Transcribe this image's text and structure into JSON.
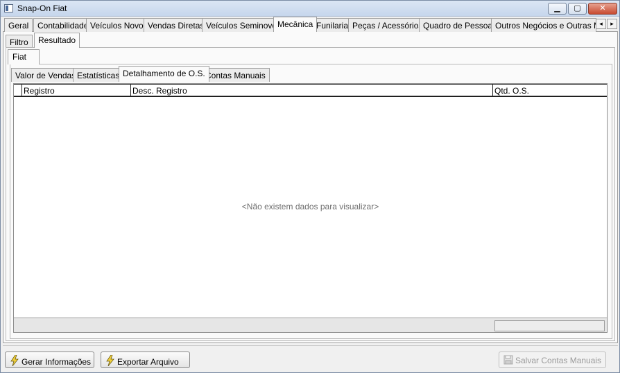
{
  "window": {
    "title": "Snap-On Fiat",
    "min_glyph": "▁",
    "max_glyph": "▢",
    "close_glyph": "✕"
  },
  "top_tabs": [
    {
      "label": "Geral"
    },
    {
      "label": "Contabilidade"
    },
    {
      "label": "Veículos Novos"
    },
    {
      "label": "Vendas Diretas"
    },
    {
      "label": "Veículos Seminovos"
    },
    {
      "label": "Mecânica",
      "active": true
    },
    {
      "label": "Funilaria"
    },
    {
      "label": "Peças / Acessórios"
    },
    {
      "label": "Quadro de Pessoas"
    },
    {
      "label": "Outros Negócios e Outras Mar"
    }
  ],
  "tab_scroll": {
    "left": "◂",
    "right": "▸"
  },
  "sub_tabs": [
    {
      "label": "Filtro"
    },
    {
      "label": "Resultado",
      "active": true
    }
  ],
  "brand_tab": {
    "label": "Fiat"
  },
  "detail_tabs": [
    {
      "label": "Valor de Vendas"
    },
    {
      "label": "Estatísticas"
    },
    {
      "label": "Detalhamento de O.S.",
      "active": true
    },
    {
      "label": "Contas Manuais"
    }
  ],
  "grid": {
    "columns": [
      "Registro",
      "Desc. Registro",
      "Qtd. O.S."
    ],
    "empty_text": "<Não existem dados para visualizar>"
  },
  "buttons": {
    "gerar": {
      "label": "Gerar Informações",
      "icon": "lightning-icon"
    },
    "exportar": {
      "label": "Exportar Arquivo",
      "icon": "lightning-icon"
    },
    "salvar": {
      "label": "Salvar Contas Manuais",
      "icon": "save-icon",
      "disabled": true
    }
  }
}
